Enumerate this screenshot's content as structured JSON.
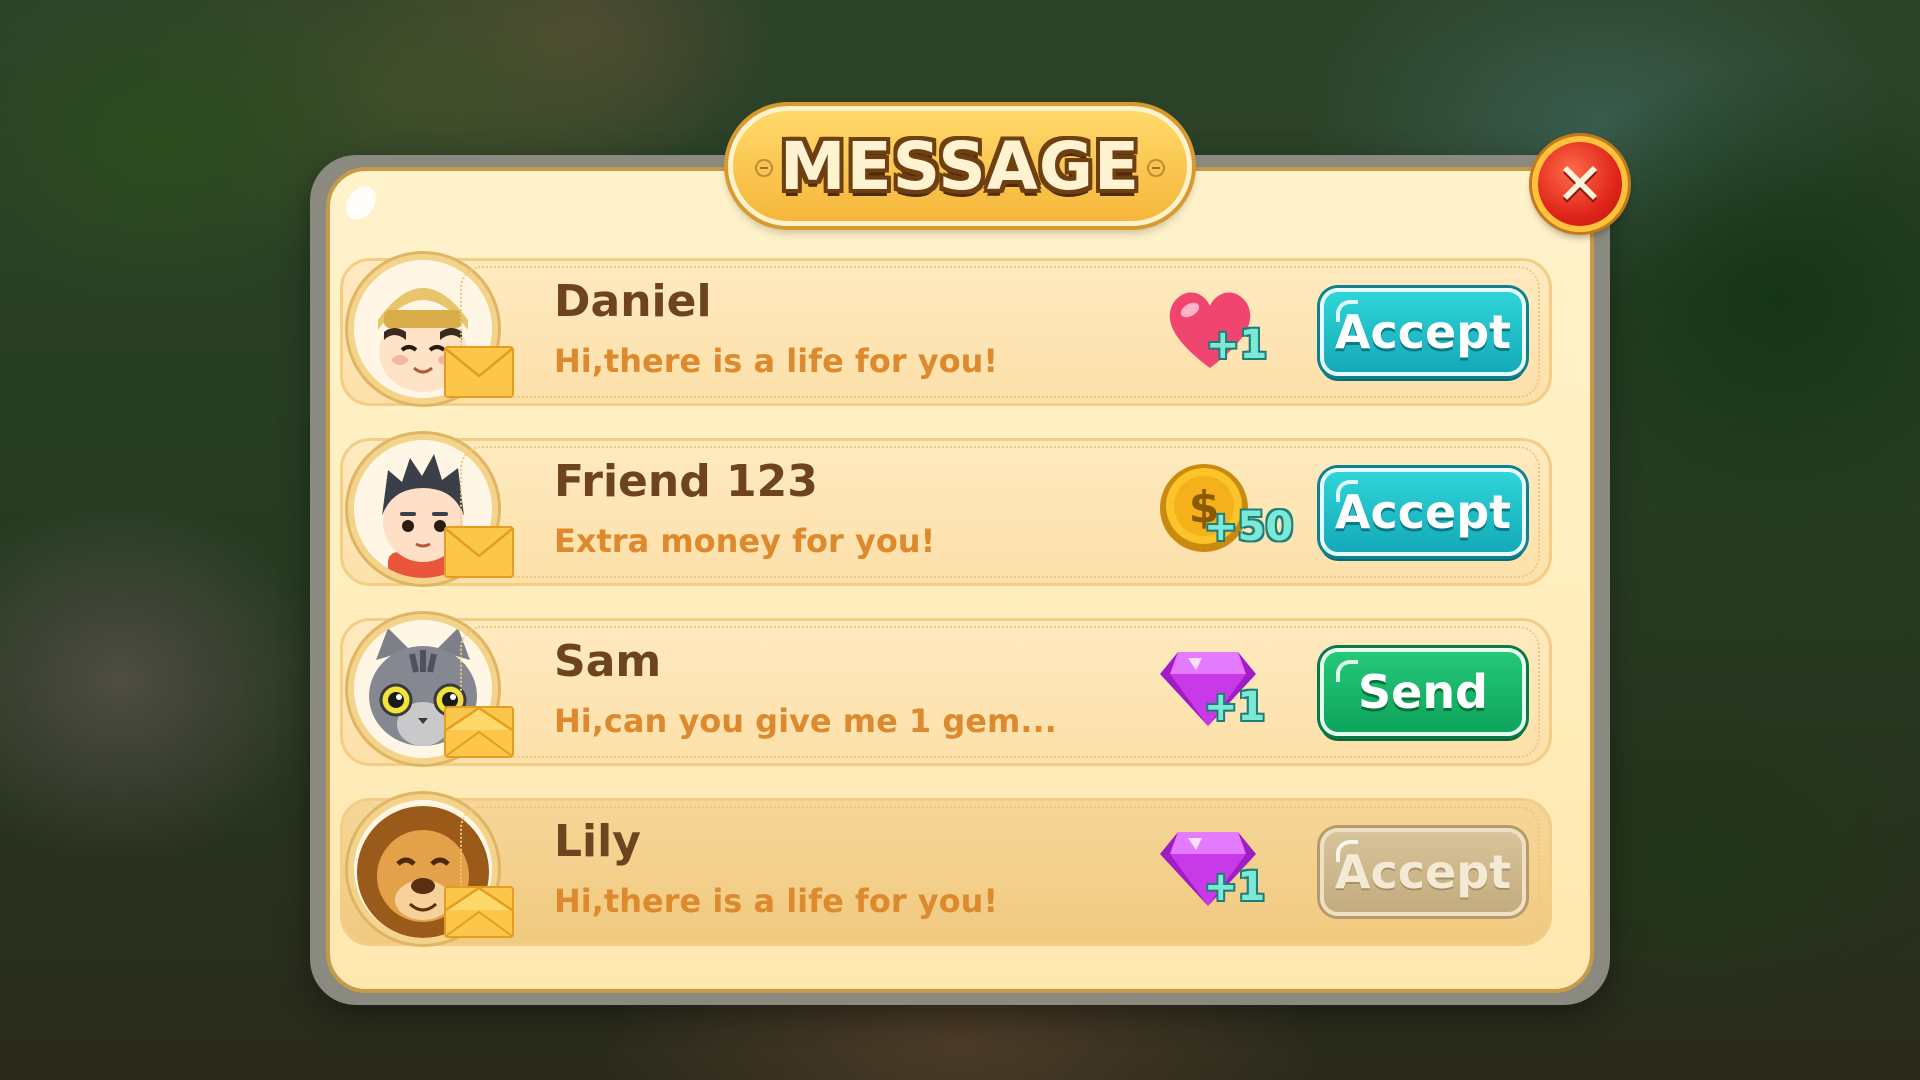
{
  "title": "MESSAGE",
  "close_symbol": "✕",
  "colors": {
    "accept_button": "#14a9b8",
    "send_button": "#0ea35b",
    "disabled_button": "#c2ab7e",
    "name_text": "#6e4420",
    "message_text": "#dd8a2e",
    "panel": "#ffe8b0"
  },
  "messages": [
    {
      "sender": "Daniel",
      "text": "Hi,there is a life for you!",
      "avatar_icon": "boy-with-hat-avatar",
      "reward_icon": "heart-icon",
      "reward_amount": "+1",
      "action": "Accept",
      "action_state": "enabled"
    },
    {
      "sender": "Friend 123",
      "text": "Extra money for you!",
      "avatar_icon": "boy-avatar",
      "reward_icon": "gold-coin-icon",
      "reward_amount": "+50",
      "action": "Accept",
      "action_state": "enabled"
    },
    {
      "sender": "Sam",
      "text": "Hi,can you give me 1 gem...",
      "avatar_icon": "cat-avatar",
      "reward_icon": "gem-icon",
      "reward_amount": "+1",
      "action": "Send",
      "action_state": "enabled"
    },
    {
      "sender": "Lily",
      "text": "Hi,there is a life for you!",
      "avatar_icon": "lion-avatar",
      "reward_icon": "gem-icon",
      "reward_amount": "+1",
      "action": "Accept",
      "action_state": "disabled"
    }
  ]
}
